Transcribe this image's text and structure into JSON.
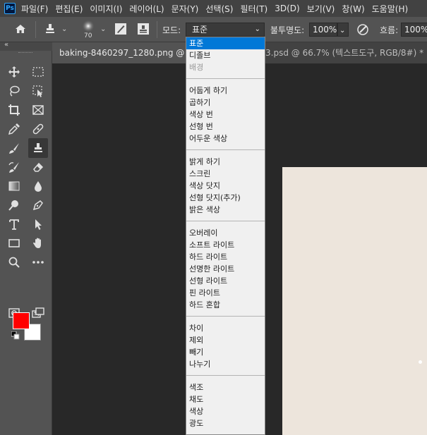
{
  "menubar": {
    "logo": "Ps",
    "items": [
      "파일(F)",
      "편집(E)",
      "이미지(I)",
      "레이어(L)",
      "문자(Y)",
      "선택(S)",
      "필터(T)",
      "3D(D)",
      "보기(V)",
      "창(W)",
      "도움말(H)"
    ]
  },
  "options": {
    "brush_size": "70",
    "mode_label": "모드:",
    "mode_value": "표준",
    "opacity_label": "불투명도:",
    "opacity_value": "100%",
    "flow_label": "흐름:",
    "flow_value": "100%"
  },
  "tabs": {
    "active": "baking-8460297_1280.png @ 66.7",
    "other": "3.psd @ 66.7% (텍스트도구, RGB/8#) * ×"
  },
  "blend_modes": {
    "items": [
      {
        "label": "표준",
        "state": "selected"
      },
      {
        "label": "디졸브",
        "state": "normal"
      },
      {
        "label": "배경",
        "state": "disabled"
      },
      {
        "label": "어둡게 하기",
        "state": "normal"
      },
      {
        "label": "곱하기",
        "state": "normal"
      },
      {
        "label": "색상 번",
        "state": "normal"
      },
      {
        "label": "선형 번",
        "state": "normal"
      },
      {
        "label": "어두운 색상",
        "state": "normal"
      },
      {
        "label": "밝게 하기",
        "state": "normal"
      },
      {
        "label": "스크린",
        "state": "normal"
      },
      {
        "label": "색상 닷지",
        "state": "normal"
      },
      {
        "label": "선형 닷지(추가)",
        "state": "normal"
      },
      {
        "label": "밝은 색상",
        "state": "normal"
      },
      {
        "label": "오버레이",
        "state": "normal"
      },
      {
        "label": "소프트 라이트",
        "state": "normal"
      },
      {
        "label": "하드 라이트",
        "state": "normal"
      },
      {
        "label": "선명한 라이트",
        "state": "normal"
      },
      {
        "label": "선형 라이트",
        "state": "normal"
      },
      {
        "label": "핀 라이트",
        "state": "normal"
      },
      {
        "label": "하드 혼합",
        "state": "normal"
      },
      {
        "label": "차이",
        "state": "normal"
      },
      {
        "label": "제외",
        "state": "normal"
      },
      {
        "label": "빼기",
        "state": "normal"
      },
      {
        "label": "나누기",
        "state": "normal"
      },
      {
        "label": "색조",
        "state": "normal"
      },
      {
        "label": "채도",
        "state": "normal"
      },
      {
        "label": "색상",
        "state": "normal"
      },
      {
        "label": "광도",
        "state": "normal"
      }
    ]
  },
  "colors": {
    "foreground": "#ff0000",
    "background": "#ffffff",
    "canvas": "#ede5dc",
    "selection": "#0078d7"
  },
  "tools": [
    "move-icon",
    "marquee-icon",
    "lasso-icon",
    "object-select-icon",
    "crop-icon",
    "frame-icon",
    "eyedropper-icon",
    "healing-icon",
    "brush-icon",
    "clone-stamp-icon",
    "history-brush-icon",
    "eraser-icon",
    "gradient-icon",
    "blur-icon",
    "dodge-icon",
    "pen-icon",
    "type-icon",
    "path-select-icon",
    "rectangle-icon",
    "hand-icon",
    "zoom-icon",
    "more-icon",
    "quick-mask-icon",
    "screen-mode-icon"
  ]
}
